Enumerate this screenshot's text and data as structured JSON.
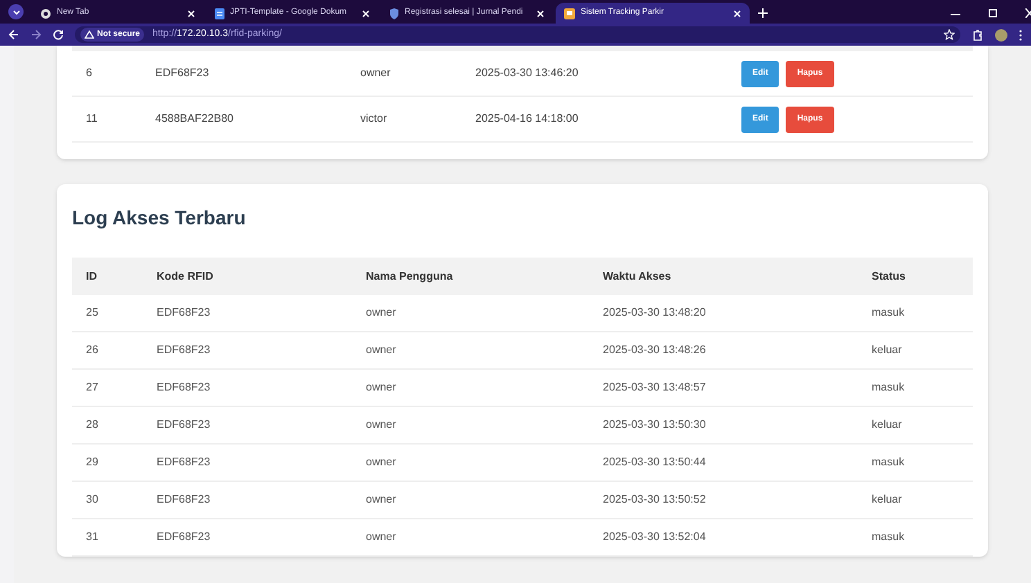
{
  "browser": {
    "tabs": [
      {
        "title": "New Tab",
        "selected": false
      },
      {
        "title": "JPTI-Template - Google Dokum",
        "selected": false
      },
      {
        "title": "Registrasi selesai | Jurnal Pendi",
        "selected": false
      },
      {
        "title": "Sistem Tracking Parkir",
        "selected": true
      }
    ],
    "security": "Not secure",
    "url": "http://**172.20.10.3**/rfid-parking/"
  },
  "cards_table": {
    "rows": [
      {
        "id": "6",
        "rfid": "EDF68F23",
        "user": "owner",
        "time": "2025-03-30 13:46:20",
        "actions": [
          "Edit",
          "Hapus"
        ]
      },
      {
        "id": "11",
        "rfid": "4588BAF22B80",
        "user": "victor",
        "time": "2025-04-16 14:18:00",
        "actions": [
          "Edit",
          "Hapus"
        ]
      }
    ]
  },
  "log": {
    "title": "Log Akses Terbaru",
    "columns": [
      "ID",
      "Kode RFID",
      "Nama Pengguna",
      "Waktu Akses",
      "Status"
    ],
    "rows": [
      [
        "25",
        "EDF68F23",
        "owner",
        "2025-03-30 13:48:20",
        "masuk"
      ],
      [
        "26",
        "EDF68F23",
        "owner",
        "2025-03-30 13:48:26",
        "keluar"
      ],
      [
        "27",
        "EDF68F23",
        "owner",
        "2025-03-30 13:48:57",
        "masuk"
      ],
      [
        "28",
        "EDF68F23",
        "owner",
        "2025-03-30 13:50:30",
        "keluar"
      ],
      [
        "29",
        "EDF68F23",
        "owner",
        "2025-03-30 13:50:44",
        "masuk"
      ],
      [
        "30",
        "EDF68F23",
        "owner",
        "2025-03-30 13:50:52",
        "keluar"
      ],
      [
        "31",
        "EDF68F23",
        "owner",
        "2025-03-30 13:52:04",
        "masuk"
      ]
    ]
  }
}
